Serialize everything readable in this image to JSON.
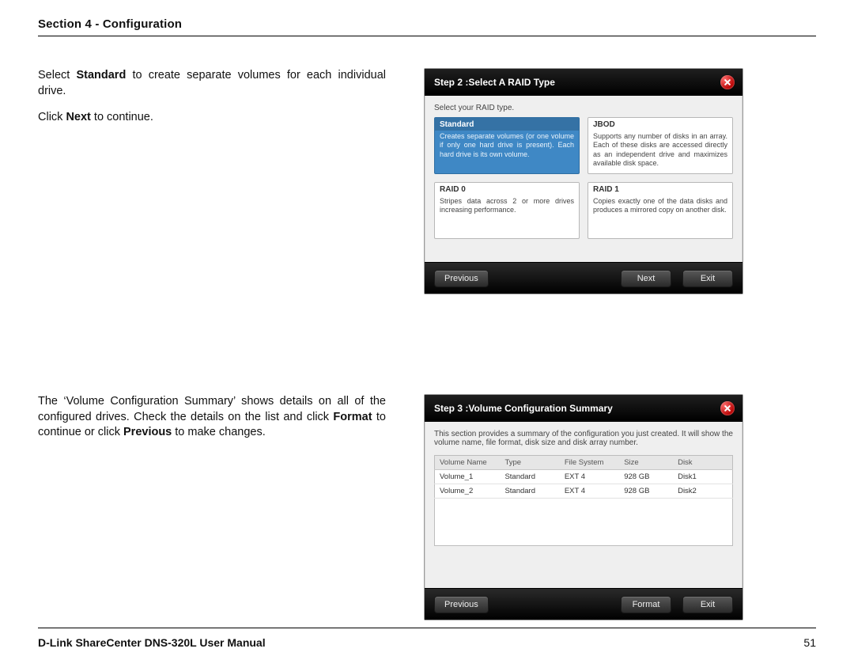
{
  "section_header": "Section 4 - Configuration",
  "footer_left": "D-Link ShareCenter DNS-320L User Manual",
  "footer_page": "51",
  "prose1": {
    "p1a": "Select ",
    "p1b_bold": "Standard",
    "p1c": " to create separate volumes for each individual drive.",
    "p2a": "Click ",
    "p2b_bold": "Next",
    "p2c": " to continue."
  },
  "prose2": {
    "t1": "The ‘Volume Configuration Summary’ shows details on all of the configured drives. Check the details on the list and click ",
    "t2_bold": "Format",
    "t3": " to continue or click ",
    "t4_bold": "Previous",
    "t5": " to make changes."
  },
  "wiz1": {
    "title": "Step 2 :Select A RAID Type",
    "instruction": "Select your RAID type.",
    "cards": {
      "standard": {
        "title": "Standard",
        "desc": "Creates separate volumes (or one volume if only one hard drive is present). Each hard drive is its own volume."
      },
      "jbod": {
        "title": "JBOD",
        "desc": "Supports any number of disks in an array. Each of these disks are accessed directly as an independent drive and maximizes available disk space."
      },
      "raid0": {
        "title": "RAID 0",
        "desc": "Stripes data across 2 or more drives increasing performance."
      },
      "raid1": {
        "title": "RAID 1",
        "desc": "Copies exactly one of the data disks and produces a mirrored copy on another disk."
      }
    },
    "buttons": {
      "previous": "Previous",
      "next": "Next",
      "exit": "Exit"
    }
  },
  "wiz2": {
    "title": "Step 3 :Volume Configuration Summary",
    "instruction": "This section provides a summary of the configuration you just created. It will show the volume name, file format, disk size and disk array number.",
    "columns": {
      "name": "Volume Name",
      "type": "Type",
      "fs": "File System",
      "size": "Size",
      "disk": "Disk"
    },
    "rows": [
      {
        "name": "Volume_1",
        "type": "Standard",
        "fs": "EXT 4",
        "size": "928 GB",
        "disk": "Disk1"
      },
      {
        "name": "Volume_2",
        "type": "Standard",
        "fs": "EXT 4",
        "size": "928 GB",
        "disk": "Disk2"
      }
    ],
    "buttons": {
      "previous": "Previous",
      "format": "Format",
      "exit": "Exit"
    }
  }
}
